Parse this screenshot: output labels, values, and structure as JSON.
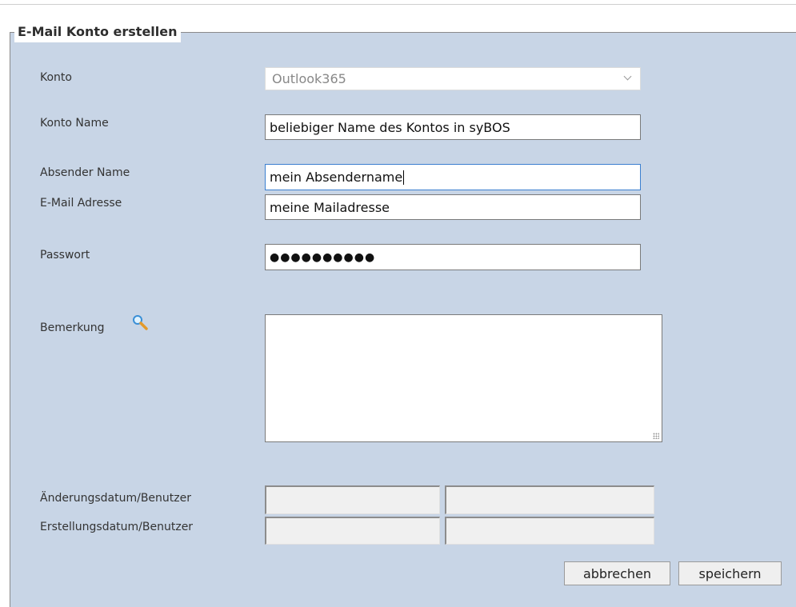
{
  "form": {
    "title": "E-Mail Konto erstellen",
    "konto": {
      "label": "Konto",
      "value": "Outlook365"
    },
    "konto_name": {
      "label": "Konto Name",
      "value": "beliebiger Name des Kontos in syBOS"
    },
    "absender_name": {
      "label": "Absender Name",
      "value": "mein Absendername"
    },
    "email": {
      "label": "E-Mail Adresse",
      "value": "meine Mailadresse"
    },
    "passwort": {
      "label": "Passwort",
      "value": "●●●●●●●●●●"
    },
    "bemerkung": {
      "label": "Bemerkung",
      "value": ""
    },
    "aenderung": {
      "label": "Änderungsdatum/Benutzer"
    },
    "erstellung": {
      "label": "Erstellungsdatum/Benutzer"
    }
  },
  "buttons": {
    "cancel": "abbrechen",
    "save": "speichern"
  },
  "colors": {
    "form_bg": "#c8d5e6",
    "active_border": "#3b7fd0"
  },
  "icons": {
    "bemerkung": "magnifier-icon"
  }
}
